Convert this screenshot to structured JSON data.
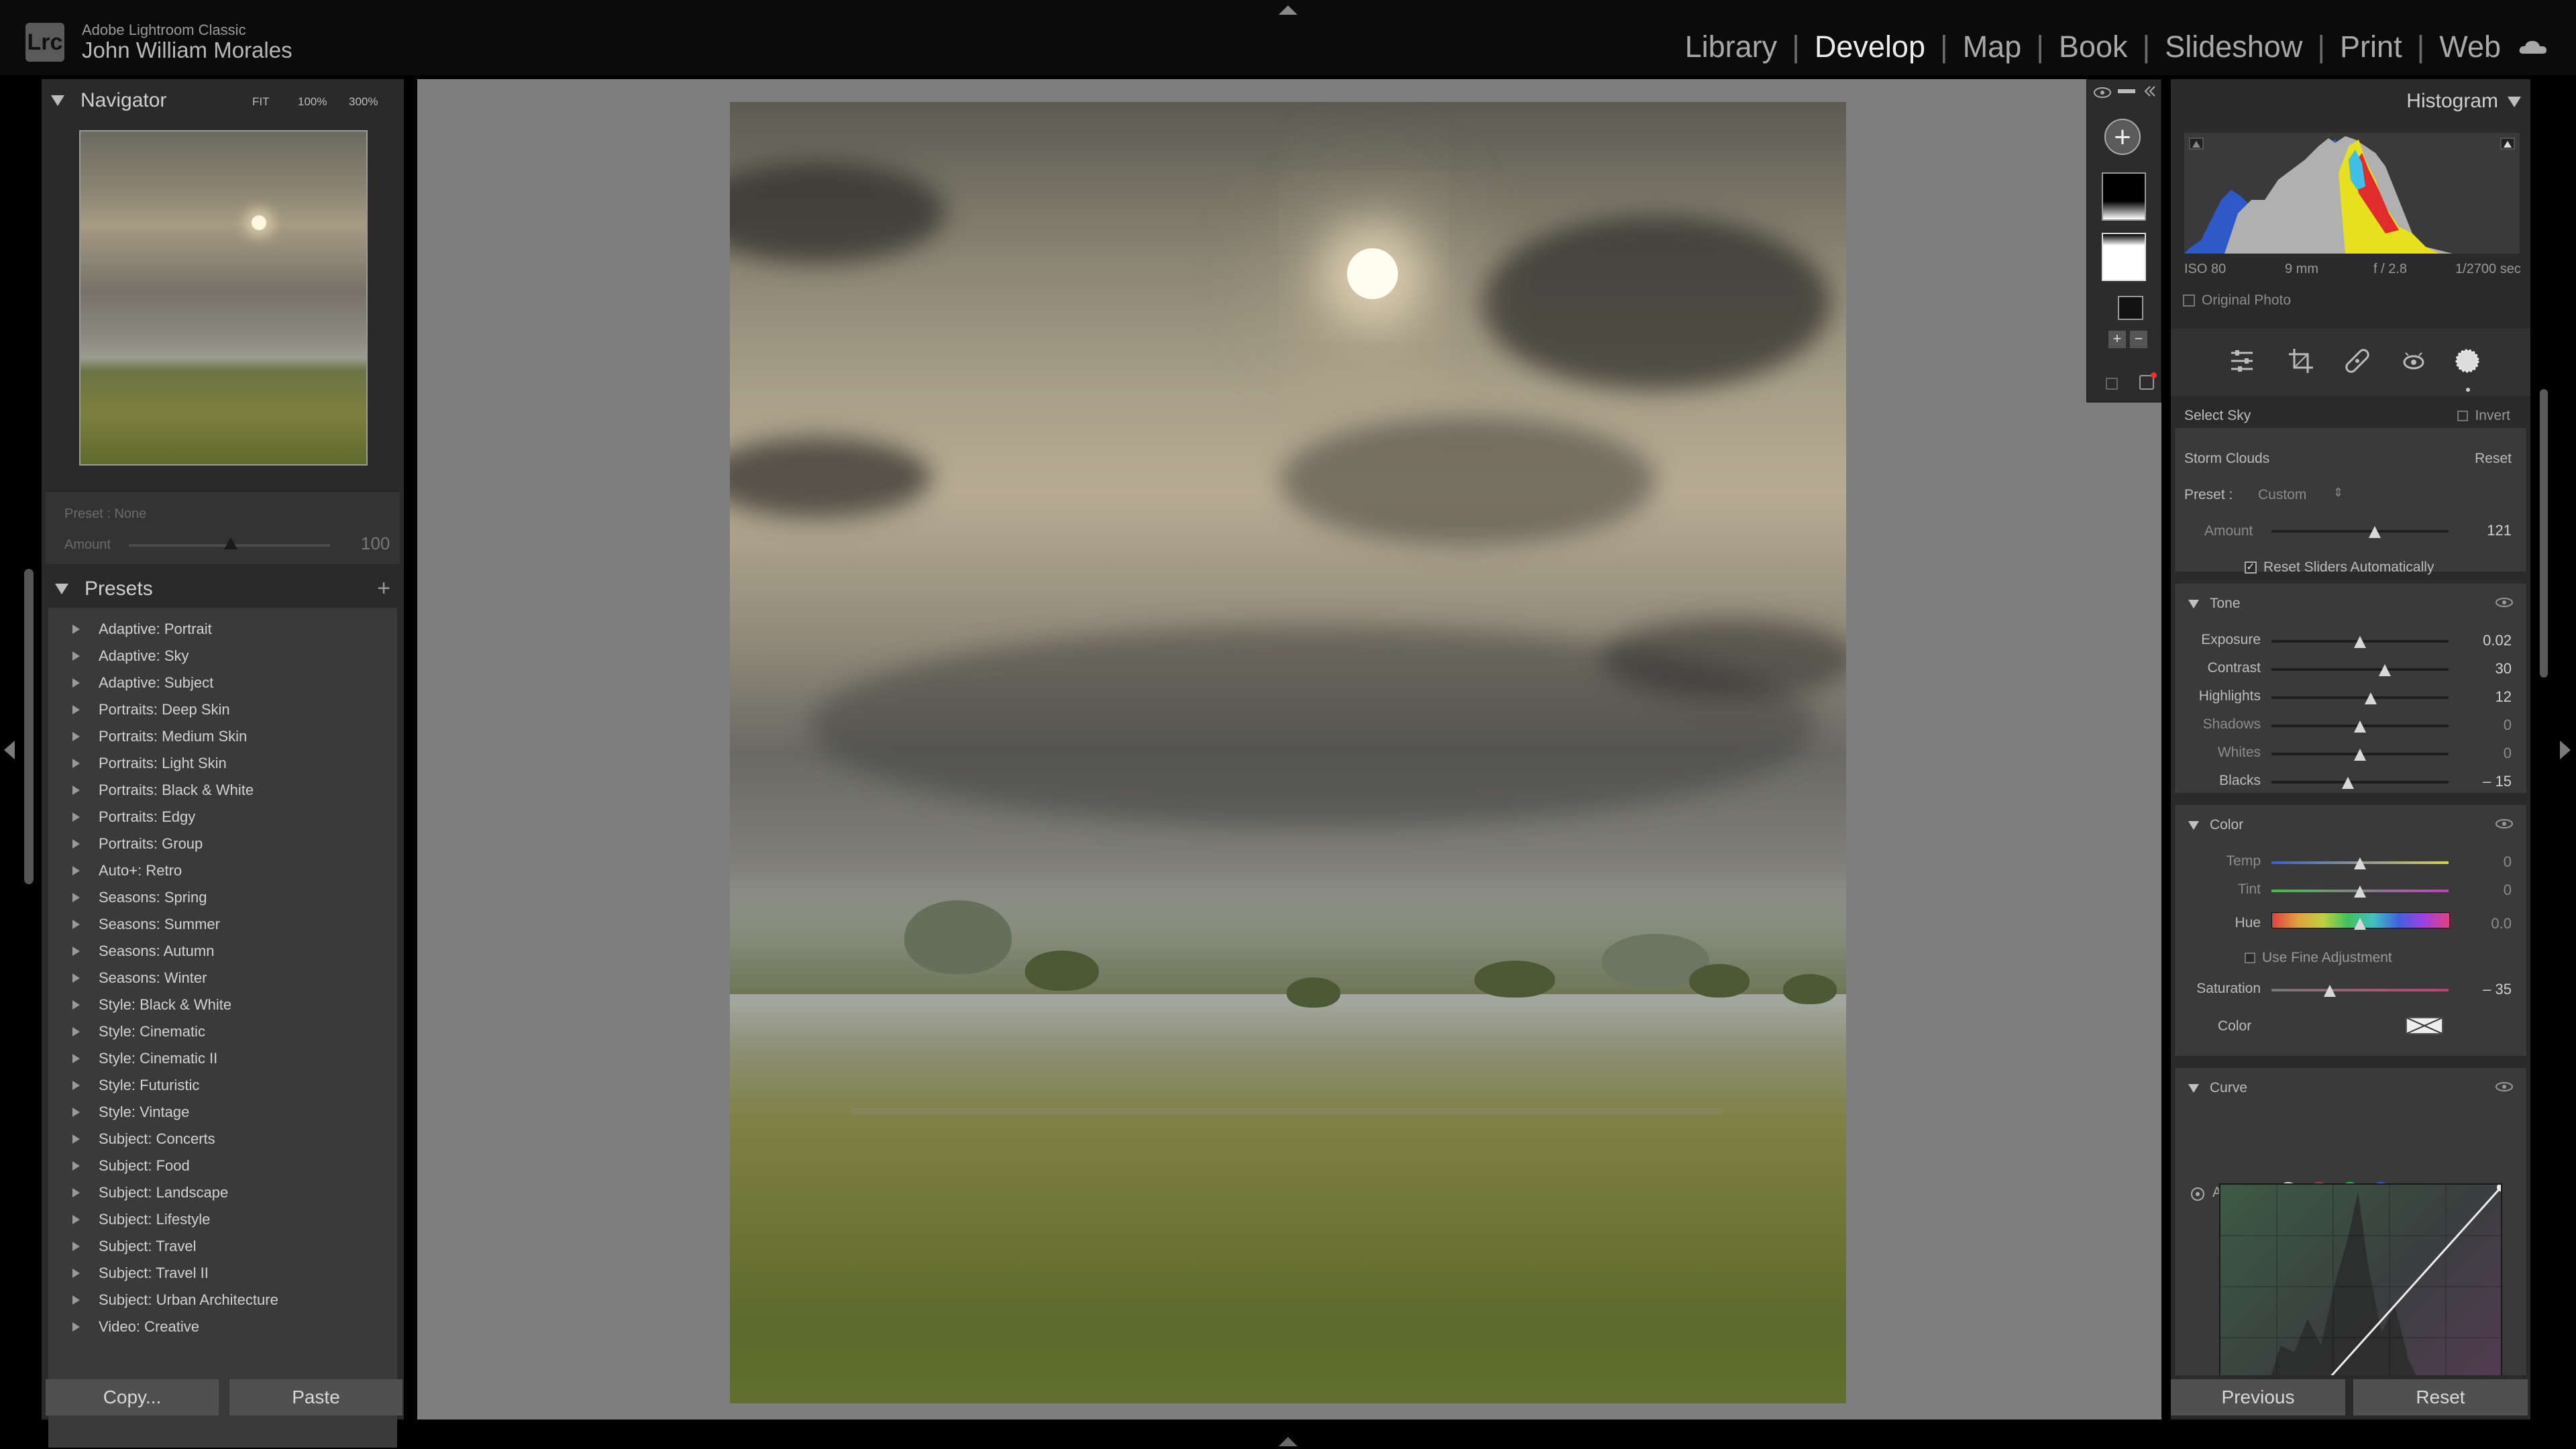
{
  "app": {
    "name": "Adobe Lightroom Classic",
    "logo": "Lrc",
    "user": "John William Morales"
  },
  "modules": [
    {
      "label": "Library",
      "active": false
    },
    {
      "label": "Develop",
      "active": true
    },
    {
      "label": "Map",
      "active": false
    },
    {
      "label": "Book",
      "active": false
    },
    {
      "label": "Slideshow",
      "active": false
    },
    {
      "label": "Print",
      "active": false
    },
    {
      "label": "Web",
      "active": false
    }
  ],
  "navigator": {
    "title": "Navigator",
    "zoom_fit": "FIT",
    "zoom_100": "100%",
    "zoom_300": "300%"
  },
  "preset_amount": {
    "preset_label": "Preset : None",
    "amount_label": "Amount",
    "amount_value": "100"
  },
  "presets": {
    "title": "Presets",
    "items": [
      "Adaptive: Portrait",
      "Adaptive: Sky",
      "Adaptive: Subject",
      "Portraits: Deep Skin",
      "Portraits: Medium Skin",
      "Portraits: Light Skin",
      "Portraits: Black & White",
      "Portraits: Edgy",
      "Portraits: Group",
      "Auto+: Retro",
      "Seasons: Spring",
      "Seasons: Summer",
      "Seasons: Autumn",
      "Seasons: Winter",
      "Style: Black & White",
      "Style: Cinematic",
      "Style: Cinematic II",
      "Style: Futuristic",
      "Style: Vintage",
      "Subject: Concerts",
      "Subject: Food",
      "Subject: Landscape",
      "Subject: Lifestyle",
      "Subject: Travel",
      "Subject: Travel II",
      "Subject: Urban Architecture",
      "Video: Creative"
    ]
  },
  "left_buttons": {
    "copy": "Copy...",
    "paste": "Paste"
  },
  "histogram": {
    "title": "Histogram",
    "iso": "ISO 80",
    "focal": "9 mm",
    "aperture": "f / 2.8",
    "shutter": "1/2700 sec",
    "original_photo": "Original Photo"
  },
  "mask": {
    "select_sky": "Select Sky",
    "invert": "Invert",
    "name": "Storm Clouds",
    "reset": "Reset",
    "preset_label": "Preset :",
    "preset_value": "Custom",
    "amount_label": "Amount",
    "amount_value": "121",
    "reset_sliders": "Reset Sliders Automatically"
  },
  "tone": {
    "title": "Tone",
    "sliders": [
      {
        "label": "Exposure",
        "value": "0.02",
        "pos": 0.5
      },
      {
        "label": "Contrast",
        "value": "30",
        "pos": 0.64
      },
      {
        "label": "Highlights",
        "value": "12",
        "pos": 0.56
      },
      {
        "label": "Shadows",
        "value": "0",
        "pos": 0.5
      },
      {
        "label": "Whites",
        "value": "0",
        "pos": 0.5
      },
      {
        "label": "Blacks",
        "value": "– 15",
        "pos": 0.43
      }
    ]
  },
  "color": {
    "title": "Color",
    "temp_label": "Temp",
    "temp_value": "0",
    "tint_label": "Tint",
    "tint_value": "0",
    "hue_label": "Hue",
    "hue_value": "0.0",
    "fine_adjust": "Use Fine Adjustment",
    "saturation_label": "Saturation",
    "saturation_value": "– 35",
    "color_label": "Color"
  },
  "curve": {
    "title": "Curve",
    "adjust_label": "Adjust"
  },
  "right_buttons": {
    "previous": "Previous",
    "reset": "Reset"
  },
  "colors": {
    "accent": "#ececec",
    "panel": "#2a2a2a",
    "section": "#3a3a3a"
  }
}
